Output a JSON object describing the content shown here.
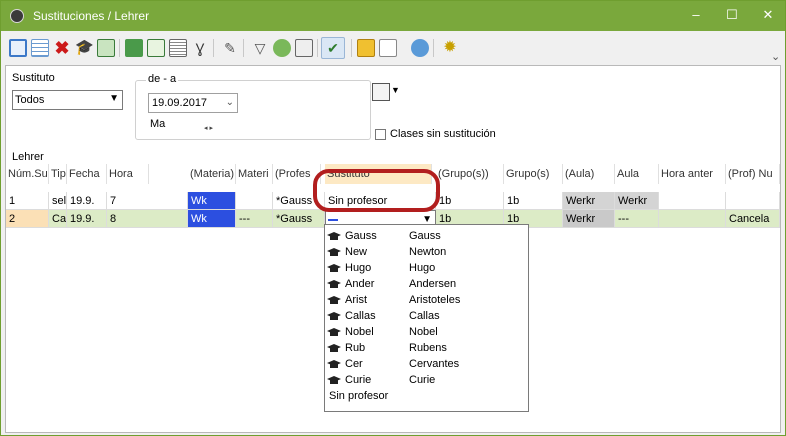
{
  "window": {
    "title": "Sustituciones / Lehrer",
    "controls": {
      "minimize": "–",
      "maximize": "☐",
      "close": "✕"
    }
  },
  "toolbar": {
    "icons": [
      "new-row-icon",
      "list-icon",
      "delete-icon",
      "teacher-icon",
      "export-icon",
      "copy-icon",
      "print-icon",
      "preview-icon",
      "stethoscope-icon",
      "magic-icon",
      "filter-icon",
      "people-icon",
      "calendar-icon",
      "check-icon",
      "lock-icon",
      "doc-icon",
      "refresh-icon",
      "settings-icon"
    ],
    "overflow": "⌄"
  },
  "filters": {
    "sustituto_label": "Sustituto",
    "sustituto_value": "Todos",
    "range_label": "de - a",
    "date_value": "19.09.2017",
    "day_label": "Ma",
    "clases_label": "Clases sin sustitución",
    "clases_checked": false
  },
  "section_label": "Lehrer",
  "grid": {
    "headers": [
      "Núm.Su",
      "Tipo",
      "Fecha",
      "Hora",
      "(Materia)",
      "Materi",
      "(Profes",
      "Sustituto",
      "(Grupo(s))",
      "Grupo(s)",
      "(Aula)",
      "Aula",
      "Hora anter",
      "(Prof) Nu"
    ],
    "rows": [
      {
        "num": "1",
        "tipo": "selb",
        "fecha": "19.9.",
        "hora": "7",
        "materia_orig": "Wk",
        "materia": "",
        "prof_orig": "*Gauss",
        "sustituto": "Sin profesor",
        "grupo_orig": "1b",
        "grupo": "1b",
        "aula_orig": "Werkr",
        "aula": "Werkr",
        "hora_ant": "",
        "prof_nu": ""
      },
      {
        "num": "2",
        "tipo": "Can",
        "fecha": "19.9.",
        "hora": "8",
        "materia_orig": "Wk",
        "materia": "---",
        "prof_orig": "*Gauss",
        "sustituto": "",
        "grupo_orig": "1b",
        "grupo": "1b",
        "aula_orig": "Werkr",
        "aula": "---",
        "hora_ant": "",
        "prof_nu": "Cancela"
      }
    ]
  },
  "dropdown": {
    "items": [
      {
        "short": "Gauss",
        "full": "Gauss"
      },
      {
        "short": "New",
        "full": "Newton"
      },
      {
        "short": "Hugo",
        "full": "Hugo"
      },
      {
        "short": "Ander",
        "full": "Andersen"
      },
      {
        "short": "Arist",
        "full": "Aristoteles"
      },
      {
        "short": "Callas",
        "full": "Callas"
      },
      {
        "short": "Nobel",
        "full": "Nobel"
      },
      {
        "short": "Rub",
        "full": "Rubens"
      },
      {
        "short": "Cer",
        "full": "Cervantes"
      },
      {
        "short": "Curie",
        "full": "Curie"
      }
    ],
    "none_option": "Sin profesor"
  },
  "colors": {
    "title_bar": "#7aa83c",
    "materia_blue": "#2c4fe0",
    "sustituto_header": "#fde9c4",
    "highlight_ring": "#b21e1e",
    "row_selected": "#dcebc6"
  }
}
